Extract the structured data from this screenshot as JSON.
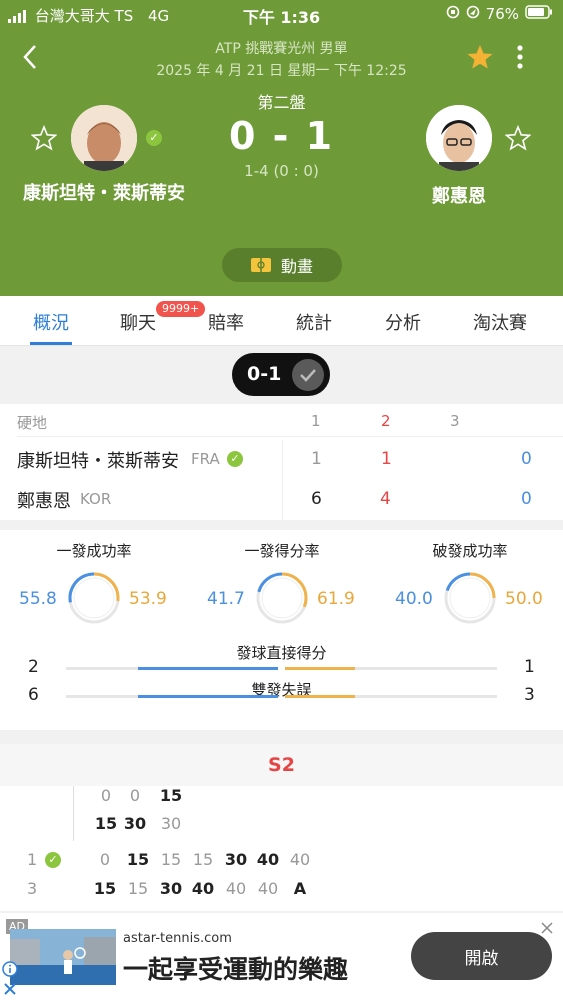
{
  "status_bar": {
    "carrier": "台灣大哥大 TS",
    "network": "4G",
    "time": "下午 1:36",
    "battery": "76%"
  },
  "match": {
    "tournament": "ATP 挑戰賽光州 男單",
    "datetime": "2025 年 4 月 21 日 星期一 下午 12:25",
    "set_label": "第二盤",
    "score": "0 - 1",
    "game_score": "1-4 (0 : 0)",
    "player1": "康斯坦特・萊斯蒂安",
    "player2": "鄭惠恩",
    "animation_label": "動畫"
  },
  "tabs": [
    "概況",
    "聊天",
    "賠率",
    "統計",
    "分析",
    "淘汰賽"
  ],
  "chat_badge": "9999+",
  "set_pill": "0-1",
  "scoreboard": {
    "surface": "硬地",
    "set_headers": [
      "1",
      "2",
      "3"
    ],
    "rows": [
      {
        "name": "康斯坦特・萊斯蒂安",
        "country": "FRA",
        "sets": [
          "1",
          "1",
          "0"
        ]
      },
      {
        "name": "鄭惠恩",
        "country": "KOR",
        "sets": [
          "6",
          "4",
          "0"
        ]
      }
    ]
  },
  "stats": {
    "rings": [
      {
        "label": "一發成功率",
        "left": "55.8",
        "right": "53.9",
        "left_value": 55.8,
        "right_value": 53.9
      },
      {
        "label": "一發得分率",
        "left": "41.7",
        "right": "61.9",
        "left_value": 41.7,
        "right_value": 61.9
      },
      {
        "label": "破發成功率",
        "left": "40.0",
        "right": "50.0",
        "left_value": 40.0,
        "right_value": 50.0
      }
    ],
    "bars": [
      {
        "label": "發球直接得分",
        "left": "2",
        "right": "1",
        "left_value": 2,
        "right_value": 1
      },
      {
        "label": "雙發失誤",
        "left": "6",
        "right": "3",
        "left_value": 6,
        "right_value": 3
      }
    ]
  },
  "points": {
    "set_label": "S2",
    "game_a": {
      "top": [
        "0",
        "0",
        "15"
      ],
      "bottom": [
        "15",
        "30",
        "30"
      ]
    },
    "game_b": {
      "top_label": "1",
      "bottom_label": "3",
      "top": [
        "0",
        "15",
        "15",
        "15",
        "30",
        "40",
        "40"
      ],
      "bottom": [
        "15",
        "15",
        "30",
        "40",
        "40",
        "40",
        "A"
      ]
    }
  },
  "ad": {
    "tag": "AD",
    "domain": "astar-tennis.com",
    "headline": "一起享受運動的樂趣",
    "button": "開啟"
  },
  "colors": {
    "header_green": "#6e9a37",
    "blue": "#4a8fe0",
    "orange": "#e9a73a",
    "red": "#e64545",
    "star": "#f5b335"
  }
}
